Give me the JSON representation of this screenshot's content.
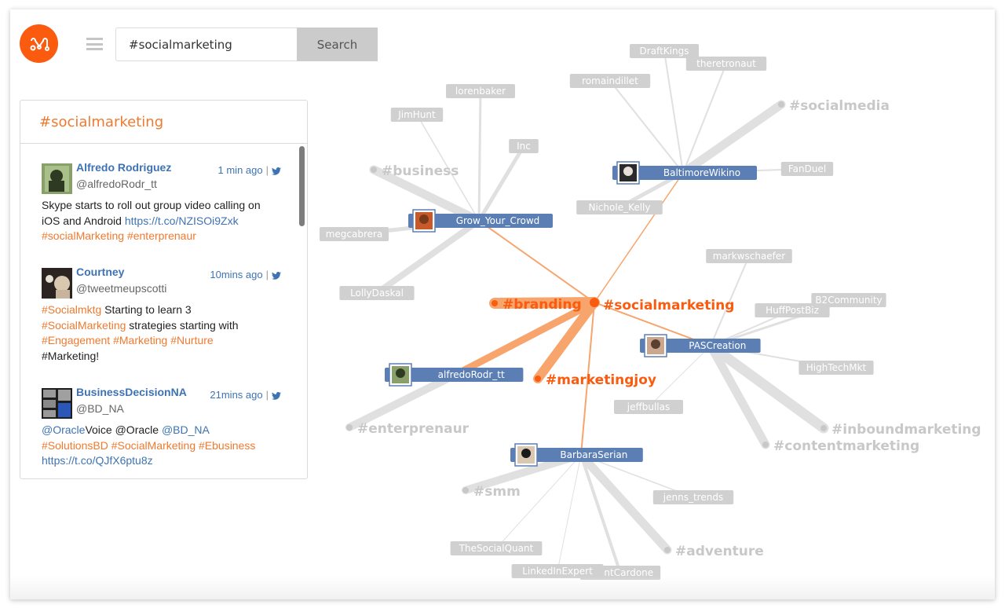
{
  "header": {
    "logo_icon": "mention-logo-icon",
    "menu_icon": "hamburger-menu-icon",
    "search": {
      "value": "#socialmarketing",
      "button_label": "Search"
    }
  },
  "panel": {
    "title": "#socialmarketing",
    "tweets": [
      {
        "name": "Alfredo Rodriguez",
        "handle": "@alfredoRodr_tt",
        "time": "1 min ago",
        "separator": "|",
        "source_icon": "twitter-bird-icon",
        "body": [
          {
            "t": "text",
            "v": "Skype starts to roll out group video calling on iOS and Android "
          },
          {
            "t": "link",
            "v": "https://t.co/NZISOi9Zxk"
          },
          {
            "t": "br"
          },
          {
            "t": "tag",
            "v": "#socialMarketing"
          },
          {
            "t": "text",
            "v": " "
          },
          {
            "t": "tag",
            "v": "#enterprenaur"
          }
        ]
      },
      {
        "name": "Courtney",
        "handle": "@tweetmeupscotti",
        "time": "10mins ago",
        "separator": "|",
        "source_icon": "twitter-bird-icon",
        "body": [
          {
            "t": "tag",
            "v": "#Socialmktg"
          },
          {
            "t": "text",
            "v": " Starting to learn 3 "
          },
          {
            "t": "br"
          },
          {
            "t": "tag",
            "v": "#SocialMarketing"
          },
          {
            "t": "text",
            "v": " strategies starting with "
          },
          {
            "t": "br"
          },
          {
            "t": "tag",
            "v": "#Engagement"
          },
          {
            "t": "text",
            "v": " "
          },
          {
            "t": "tag",
            "v": "#Marketing"
          },
          {
            "t": "text",
            "v": " "
          },
          {
            "t": "tag",
            "v": "#Nurture"
          },
          {
            "t": "br"
          },
          {
            "t": "text",
            "v": "#Marketing!"
          }
        ]
      },
      {
        "name": "BusinessDecisionNA",
        "handle": "@BD_NA",
        "time": "21mins ago",
        "separator": "|",
        "source_icon": "twitter-bird-icon",
        "body": [
          {
            "t": "link",
            "v": "@Oracle"
          },
          {
            "t": "text",
            "v": "Voice @Oracle "
          },
          {
            "t": "link",
            "v": "@BD_NA"
          },
          {
            "t": "br"
          },
          {
            "t": "tag",
            "v": "#SolutionsBD"
          },
          {
            "t": "text",
            "v": " "
          },
          {
            "t": "tag",
            "v": "#SocialMarketing"
          },
          {
            "t": "text",
            "v": " "
          },
          {
            "t": "tag",
            "v": "#Ebusiness"
          },
          {
            "t": "br"
          },
          {
            "t": "link",
            "v": "https://t.co/QJfX6ptu8z"
          }
        ]
      }
    ]
  },
  "graph": {
    "colors": {
      "accent": "#fa5b0f",
      "accent_edge": "#f7a56c",
      "user_node": "#5b7fb5",
      "grey_node": "#d0d0d0",
      "grey_edge": "#e0e0e0",
      "grey_tag": "#c8c8c8"
    },
    "center": {
      "id": "socialmarketing",
      "label": "#socialmarketing"
    },
    "orange_tags": [
      {
        "id": "branding",
        "label": "#branding"
      },
      {
        "id": "marketingjoy",
        "label": "#marketingjoy"
      }
    ],
    "users": [
      {
        "id": "grow",
        "label": "Grow_Your_Crowd"
      },
      {
        "id": "baltimore",
        "label": "BaltimoreWikino"
      },
      {
        "id": "alfredo",
        "label": "alfredoRodr_tt"
      },
      {
        "id": "pas",
        "label": "PASCreation"
      },
      {
        "id": "barbara",
        "label": "BarbaraSerian"
      }
    ],
    "grey_tags": [
      {
        "id": "business",
        "label": "#business"
      },
      {
        "id": "socialmedia",
        "label": "#socialmedia"
      },
      {
        "id": "enterprenaur",
        "label": "#enterprenaur"
      },
      {
        "id": "inbound",
        "label": "#inboundmarketing"
      },
      {
        "id": "content",
        "label": "#contentmarketing"
      },
      {
        "id": "smm",
        "label": "#smm"
      },
      {
        "id": "adventure",
        "label": "#adventure"
      }
    ],
    "accounts": [
      {
        "id": "lorenbaker",
        "label": "lorenbaker"
      },
      {
        "id": "jimhunt",
        "label": "JimHunt"
      },
      {
        "id": "inc",
        "label": "Inc"
      },
      {
        "id": "megcabrera",
        "label": "megcabrera"
      },
      {
        "id": "lolly",
        "label": "LollyDaskal"
      },
      {
        "id": "draftkings",
        "label": "DraftKings"
      },
      {
        "id": "theretronaut",
        "label": "theretronaut"
      },
      {
        "id": "romain",
        "label": "romaindillet"
      },
      {
        "id": "fanduel",
        "label": "FanDuel"
      },
      {
        "id": "nichole",
        "label": "Nichole_Kelly"
      },
      {
        "id": "markw",
        "label": "markwschaefer"
      },
      {
        "id": "b2c",
        "label": "B2Community"
      },
      {
        "id": "huff",
        "label": "HuffPostBiz"
      },
      {
        "id": "hightech",
        "label": "HighTechMkt"
      },
      {
        "id": "jeffbullas",
        "label": "jeffbullas"
      },
      {
        "id": "jenns",
        "label": "jenns_trends"
      },
      {
        "id": "tsq",
        "label": "TheSocialQuant"
      },
      {
        "id": "cardone",
        "label": "GrantCardone"
      },
      {
        "id": "linkedin",
        "label": "LinkedInExpert"
      }
    ]
  }
}
